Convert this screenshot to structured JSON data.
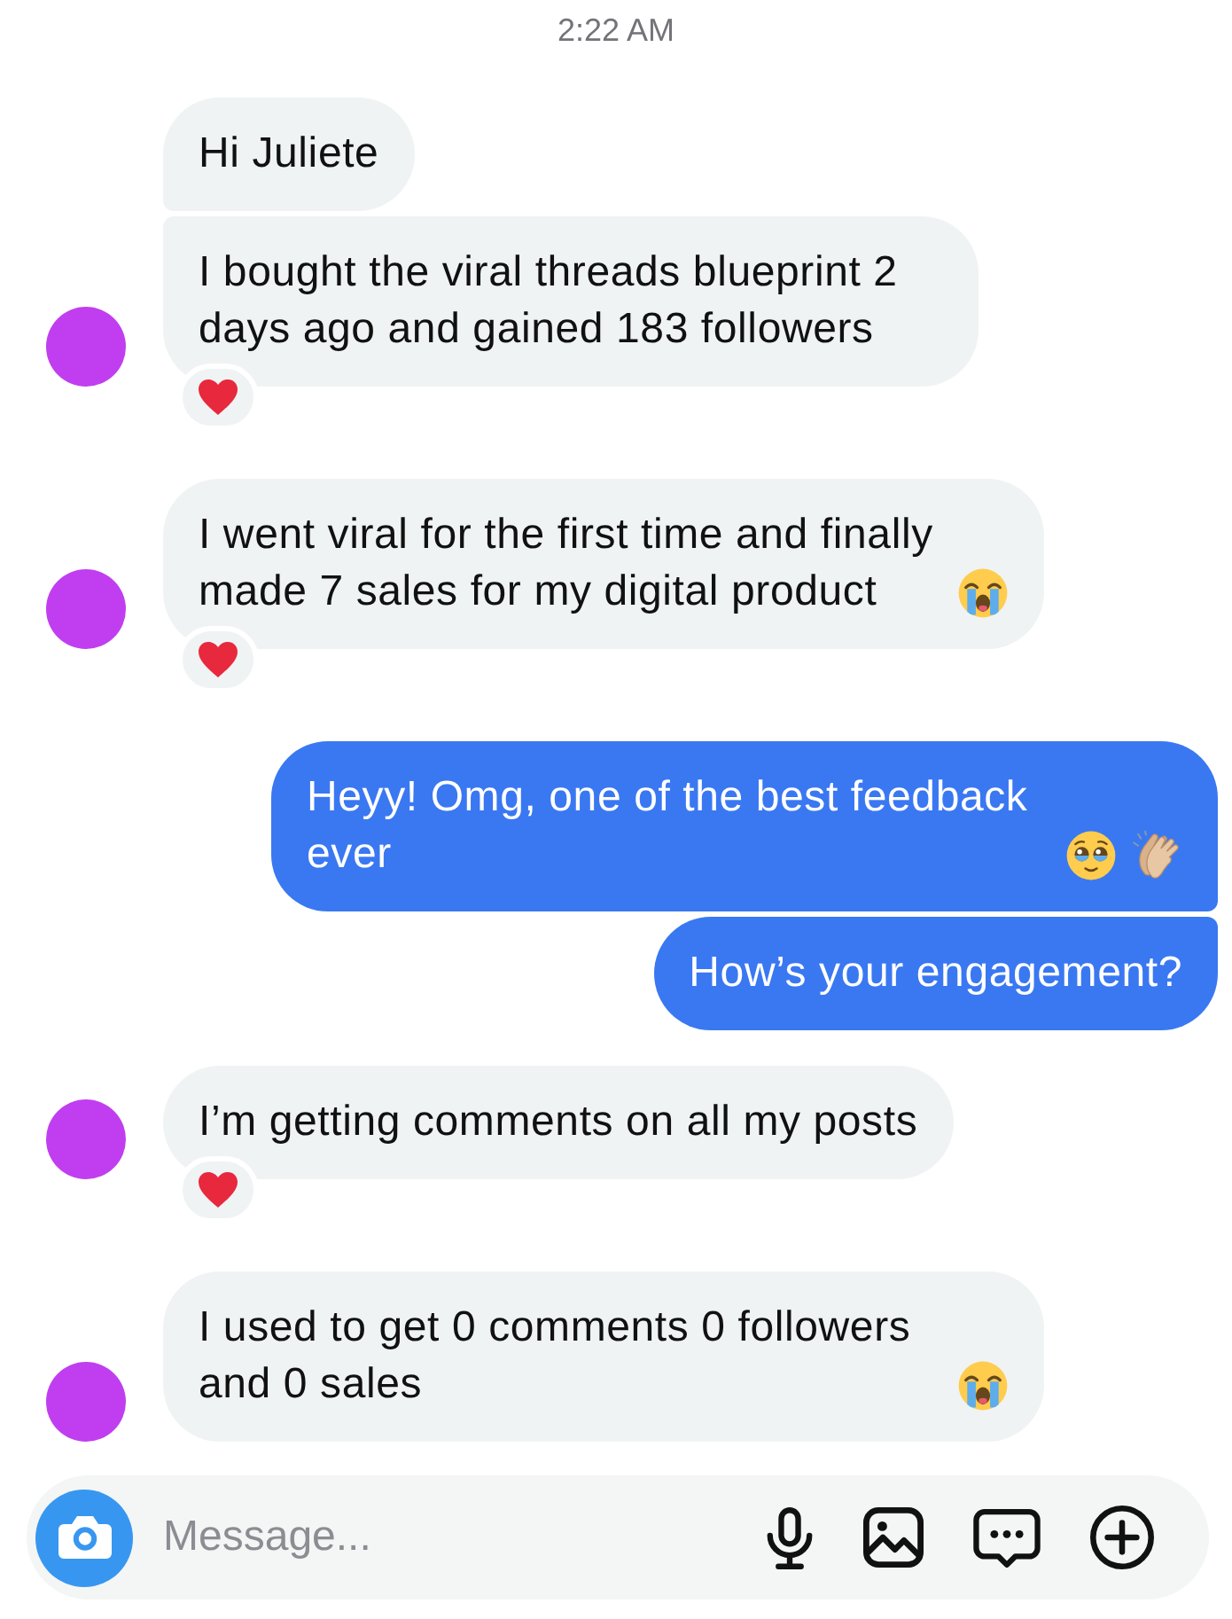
{
  "timestamp": "2:22 AM",
  "messages": [
    {
      "kind": "incoming",
      "text": "Hi Juliete"
    },
    {
      "kind": "incoming",
      "text": "I bought the viral threads blueprint 2 days ago and gained 183 followers",
      "reaction": {
        "kind": "heart"
      }
    },
    {
      "kind": "incoming",
      "text": "I went viral for the first time and finally made 7 sales for my digital product",
      "emojis": [
        {
          "kind": "crying"
        }
      ],
      "reaction": {
        "kind": "heart"
      }
    },
    {
      "kind": "outgoing",
      "text": "Heyy! Omg, one of the best feedback ever",
      "emojis": [
        {
          "kind": "pleading"
        },
        {
          "kind": "clapping"
        }
      ]
    },
    {
      "kind": "outgoing",
      "text": "How’s your engagement?"
    },
    {
      "kind": "incoming",
      "text": "I’m getting comments on all my posts",
      "reaction": {
        "kind": "heart"
      }
    },
    {
      "kind": "incoming",
      "text": "I used to get 0 comments 0 followers and 0 sales",
      "emojis": [
        {
          "kind": "crying"
        }
      ]
    }
  ],
  "composer": {
    "placeholder": "Message..."
  }
}
